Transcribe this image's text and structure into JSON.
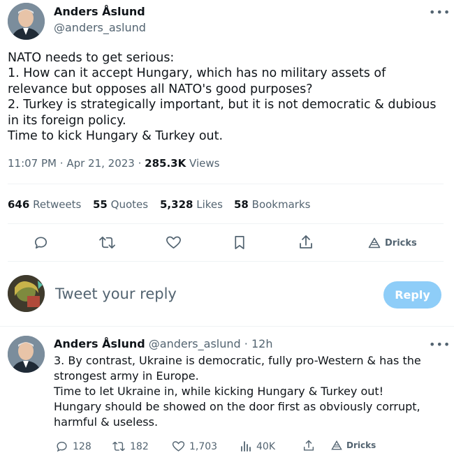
{
  "main_tweet": {
    "author_name": "Anders Åslund",
    "handle": "@anders_aslund",
    "text": "NATO needs to get serious:\n1. How can it accept Hungary, which has no military assets of relevance but opposes all NATO's good purposes?\n2. Turkey is strategically important, but it is not democratic & dubious in its foreign policy.\nTime to kick Hungary & Turkey out.",
    "time": "11:07 PM",
    "date": "Apr 21, 2023",
    "views_count": "285.3K",
    "views_label": "Views",
    "stats": {
      "retweets_count": "646",
      "retweets_label": "Retweets",
      "quotes_count": "55",
      "quotes_label": "Quotes",
      "likes_count": "5,328",
      "likes_label": "Likes",
      "bookmarks_count": "58",
      "bookmarks_label": "Bookmarks"
    },
    "actions": {
      "dricks_label": "Dricks"
    }
  },
  "composer": {
    "placeholder": "Tweet your reply",
    "reply_button": "Reply"
  },
  "reply_tweet": {
    "author_name": "Anders Åslund",
    "handle": "@anders_aslund",
    "age": "12h",
    "text": "3. By contrast, Ukraine is democratic, fully pro-Western & has the strongest army in Europe.\nTime to let Ukraine in, while kicking Hungary & Turkey out!\nHungary should be showed on the door first as obviously corrupt, harmful & useless.",
    "actions": {
      "replies": "128",
      "retweets": "182",
      "likes": "1,703",
      "views": "40K",
      "dricks_label": "Dricks"
    }
  },
  "colors": {
    "text": "#0f1419",
    "muted": "#536471",
    "divider": "#eff3f4",
    "reply_button_disabled": "#8ecdf8"
  },
  "icons": [
    "more-icon",
    "reply-icon",
    "retweet-icon",
    "like-icon",
    "bookmark-icon",
    "share-icon",
    "dricks-icon",
    "views-icon"
  ]
}
